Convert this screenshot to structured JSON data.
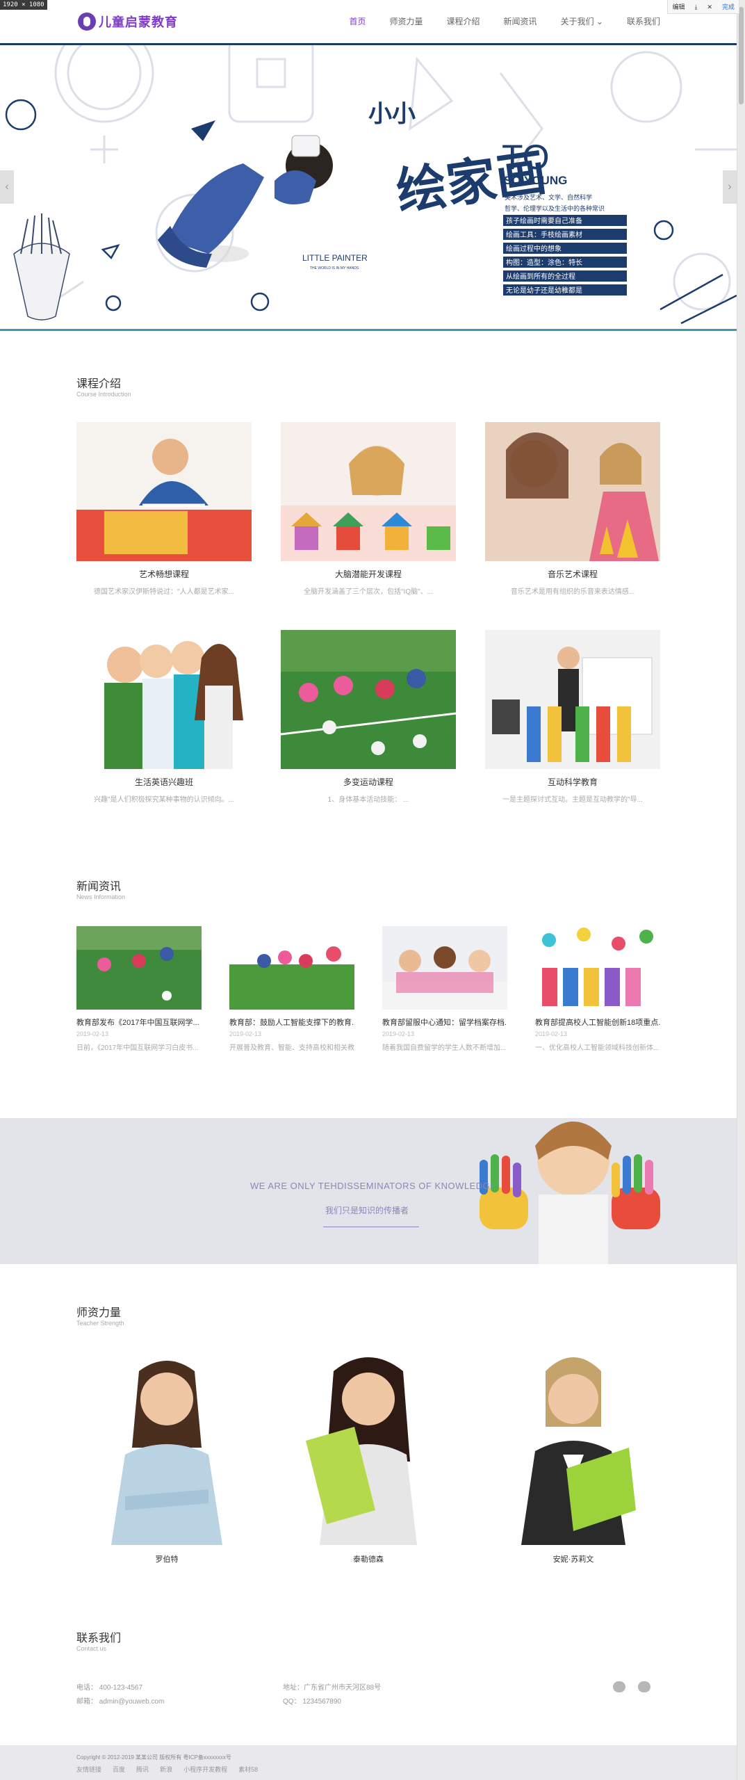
{
  "overlay": {
    "dimensions_tag": "1920 × 1080",
    "toolbar": {
      "edit": "编辑",
      "done": "完成"
    }
  },
  "header": {
    "logo_text": "儿童启蒙教育",
    "nav": [
      "首页",
      "师资力量",
      "课程介绍",
      "新闻资讯",
      "关于我们",
      "联系我们"
    ],
    "active_index": 0
  },
  "hero": {
    "title_small": "小小",
    "title_big": "绘家画",
    "to": "TO",
    "so_young": "SO YOUNG",
    "subtitle_line1": "美术涉及艺术、文学、自然科学",
    "subtitle_line2": "哲学、伦理学以及生活中的各种常识",
    "poem": [
      "孩子绘画时需要自己准备",
      "绘画工具：手枝绘画素材",
      "绘画过程中的想象",
      "构图：造型：涂色：特长",
      "从绘画到所有的全过程",
      "无论是幼子还是幼稚都是"
    ],
    "little_painter": "LITTLE PAINTER",
    "little_painter_sub": "THE WORLD IS IN MY HANDS",
    "prev": "‹",
    "next": "›"
  },
  "courses": {
    "title": "课程介绍",
    "subtitle": "Course Introduction",
    "items": [
      {
        "name": "艺术畅想课程",
        "desc": "德国艺术家汉伊斯特说过：\"人人都是艺术家..."
      },
      {
        "name": "大脑潜能开发课程",
        "desc": "全脑开发涵盖了三个层次，包括\"IQ脑\"、..."
      },
      {
        "name": "音乐艺术课程",
        "desc": "音乐艺术是用有组织的乐音来表达情感..."
      },
      {
        "name": "生活英语兴趣班",
        "desc": "兴趣\"是人们积极探究某种事物的认识倾向。..."
      },
      {
        "name": "多变运动课程",
        "desc": "1、身体基本活动技能：  ..."
      },
      {
        "name": "互动科学教育",
        "desc": "一是主题探讨式互动。主题是互动教学的\"导..."
      }
    ]
  },
  "news": {
    "title": "新闻资讯",
    "subtitle": "News Information",
    "items": [
      {
        "title": "教育部发布《2017年中国互联网学...",
        "date": "2019-02-13",
        "desc": "日前，《2017年中国互联网学习白皮书..."
      },
      {
        "title": "教育部：鼓励人工智能支撑下的教育...",
        "date": "2019-02-13",
        "desc": "开展普及教育、智能、支持高校和相关教..."
      },
      {
        "title": "教育部留服中心通知：留学档案存档...",
        "date": "2019-02-13",
        "desc": "随着我国自费留学的学生人数不断增加..."
      },
      {
        "title": "教育部提高校人工智能创新18项重点...",
        "date": "2019-02-13",
        "desc": "一、优化高校人工智能领域科技创新体..."
      }
    ]
  },
  "banner": {
    "en": "WE ARE ONLY TEHDISSEMINATORS OF KNOWLEDGE",
    "cn": "我们只是知识的传播者"
  },
  "teachers": {
    "title": "师资力量",
    "subtitle": "Teacher Strength",
    "items": [
      {
        "name": "罗伯特"
      },
      {
        "name": "泰勒德森"
      },
      {
        "name": "安妮·苏莉文"
      }
    ]
  },
  "contact": {
    "title": "联系我们",
    "subtitle": "Contact us",
    "phone": "电话：  400-123-4567",
    "email": "邮箱：  admin@youweb.com",
    "address": "地址：广东省广州市天河区88号",
    "qq": "QQ：  1234567890"
  },
  "footer": {
    "copyright": "Copyright © 2012-2019 某某公司 版权所有 粤ICP备xxxxxxxx号",
    "links": [
      "友情链接",
      "百度",
      "腾讯",
      "新浪",
      "小程序开发教程",
      "素材58"
    ]
  },
  "colors": {
    "brand": "#7e3cc8",
    "hero_navy": "#1d3c6e",
    "hero_teal": "#3a9ab0",
    "banner_text": "#8b86b8"
  }
}
